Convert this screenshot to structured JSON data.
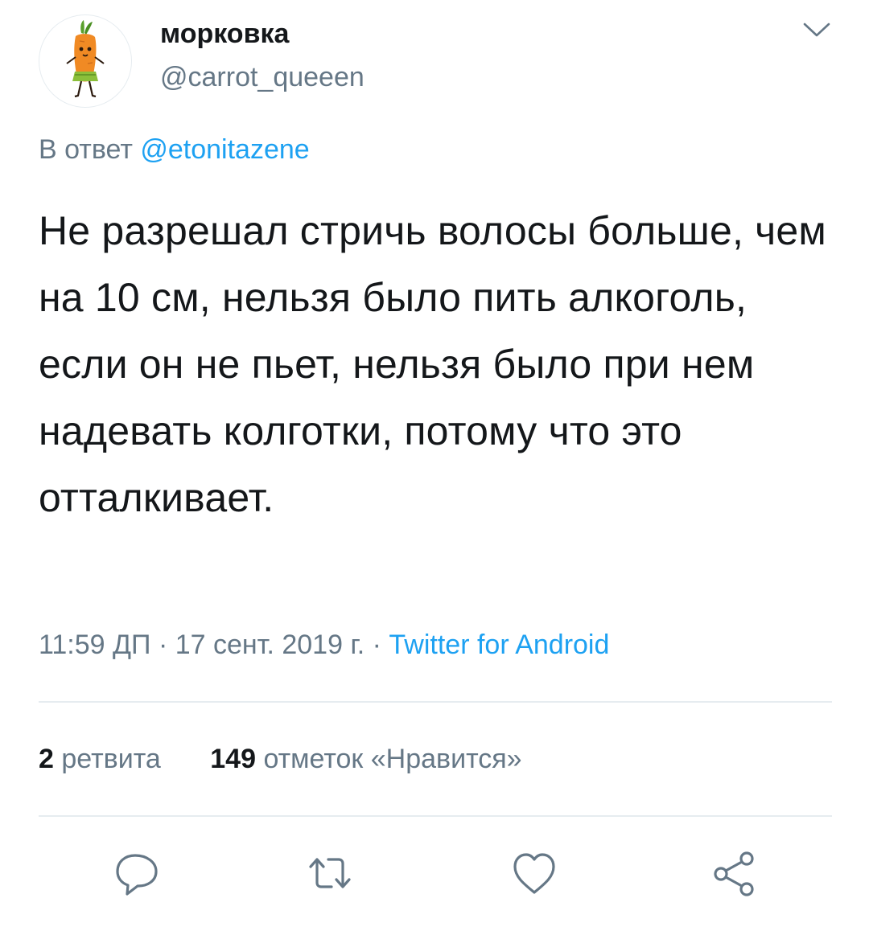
{
  "tweet": {
    "author": {
      "display_name": "морковка",
      "handle": "@carrot_queeen",
      "avatar_icon": "carrot-character-avatar"
    },
    "reply_to": {
      "prefix": "В ответ",
      "mention": "@etonitazene"
    },
    "text": "Не разрешал стричь волосы больше, чем на 10 см, нельзя было пить алкоголь, если он не пьет, нельзя было при нем надевать колготки, потому что это отталкивает.",
    "meta": {
      "time": "11:59 ДП",
      "separator": "·",
      "date": "17 сент. 2019 г.",
      "source": "Twitter for Android"
    },
    "stats": {
      "retweets_count": "2",
      "retweets_label": "ретвита",
      "likes_count": "149",
      "likes_label": "отметок «Нравится»"
    },
    "actions": {
      "icons": [
        "reply-icon",
        "retweet-icon",
        "like-icon",
        "share-icon"
      ]
    }
  },
  "colors": {
    "text_primary": "#14171a",
    "text_secondary": "#657786",
    "accent": "#1da1f2",
    "divider": "#e6ecf0"
  }
}
